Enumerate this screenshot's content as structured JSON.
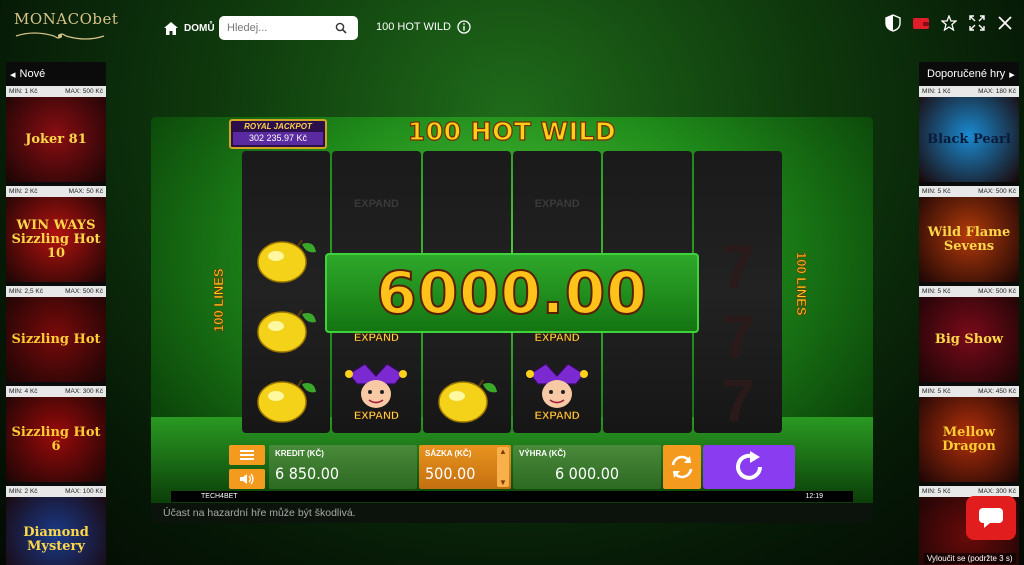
{
  "header": {
    "logo_text": "MONACObet",
    "home_label": "DOMŮ",
    "search_placeholder": "Hledej...",
    "game_title": "100 HOT WILD"
  },
  "left_panel": {
    "title": "Nové",
    "games": [
      {
        "min": "MIN: 1 Kč",
        "max": "MAX: 500 Kč",
        "name": "Joker 81",
        "bg": "#8a0d12",
        "fg": "#ffd84a"
      },
      {
        "min": "MIN: 2 Kč",
        "max": "MAX: 50 Kč",
        "name": "WIN WAYS Sizzling Hot 10",
        "bg": "#b3120f",
        "fg": "#ffd84a"
      },
      {
        "min": "MIN: 2,5 Kč",
        "max": "MAX: 500 Kč",
        "name": "Sizzling Hot",
        "bg": "#7a0a0a",
        "fg": "#ffcc33"
      },
      {
        "min": "MIN: 4 Kč",
        "max": "MAX: 300 Kč",
        "name": "Sizzling Hot 6",
        "bg": "#9a0a0a",
        "fg": "#ffcc33"
      },
      {
        "min": "MIN: 2 Kč",
        "max": "MAX: 100 Kč",
        "name": "Diamond Mystery",
        "bg": "#1a3a8a",
        "fg": "#ffd84a"
      }
    ]
  },
  "right_panel": {
    "title": "Doporučené hry",
    "games": [
      {
        "min": "MIN: 1 Kč",
        "max": "MAX: 180 Kč",
        "name": "Black Pearl",
        "bg": "#1a8ad0",
        "fg": "#0a1a3a"
      },
      {
        "min": "MIN: 5 Kč",
        "max": "MAX: 500 Kč",
        "name": "Wild Flame Sevens",
        "bg": "#b33a0a",
        "fg": "#ffd84a"
      },
      {
        "min": "MIN: 5 Kč",
        "max": "MAX: 500 Kč",
        "name": "Big Show",
        "bg": "#7a0a1a",
        "fg": "#ffd84a"
      },
      {
        "min": "MIN: 5 Kč",
        "max": "MAX: 450 Kč",
        "name": "Mellow Dragon",
        "bg": "#b3300a",
        "fg": "#ffcc33"
      },
      {
        "min": "MIN: 5 Kč",
        "max": "MAX: 300 Kč",
        "name": "",
        "bg": "#6a0a0a",
        "fg": "#ffcc33"
      }
    ]
  },
  "game": {
    "title": "100 HOT WILD",
    "jackpot_label": "ROYAL JACKPOT",
    "jackpot_value": "302 235.97 Kč",
    "lines_label": "100 LINES",
    "win_banner": "6000.00",
    "expand_label": "EXPAND",
    "provider": "TECH4BET",
    "clock": "12:19"
  },
  "controls": {
    "credit_label": "KREDIT (KČ)",
    "credit_value": "6 850.00",
    "bet_label": "SÁZKA (KČ)",
    "bet_value": "500.00",
    "win_label": "VÝHRA (KČ)",
    "win_value": "6 000.00"
  },
  "footer": {
    "disclaimer": "Účast na hazardní hře může být škodlivá.",
    "chat_note": "Vyloučit se (podržte 3 s)"
  },
  "colors": {
    "accent_orange": "#f39a1f",
    "spin_purple": "#8a3cf0",
    "panel_green": "#3c7a30",
    "title_gold": "#ffcf1a"
  }
}
